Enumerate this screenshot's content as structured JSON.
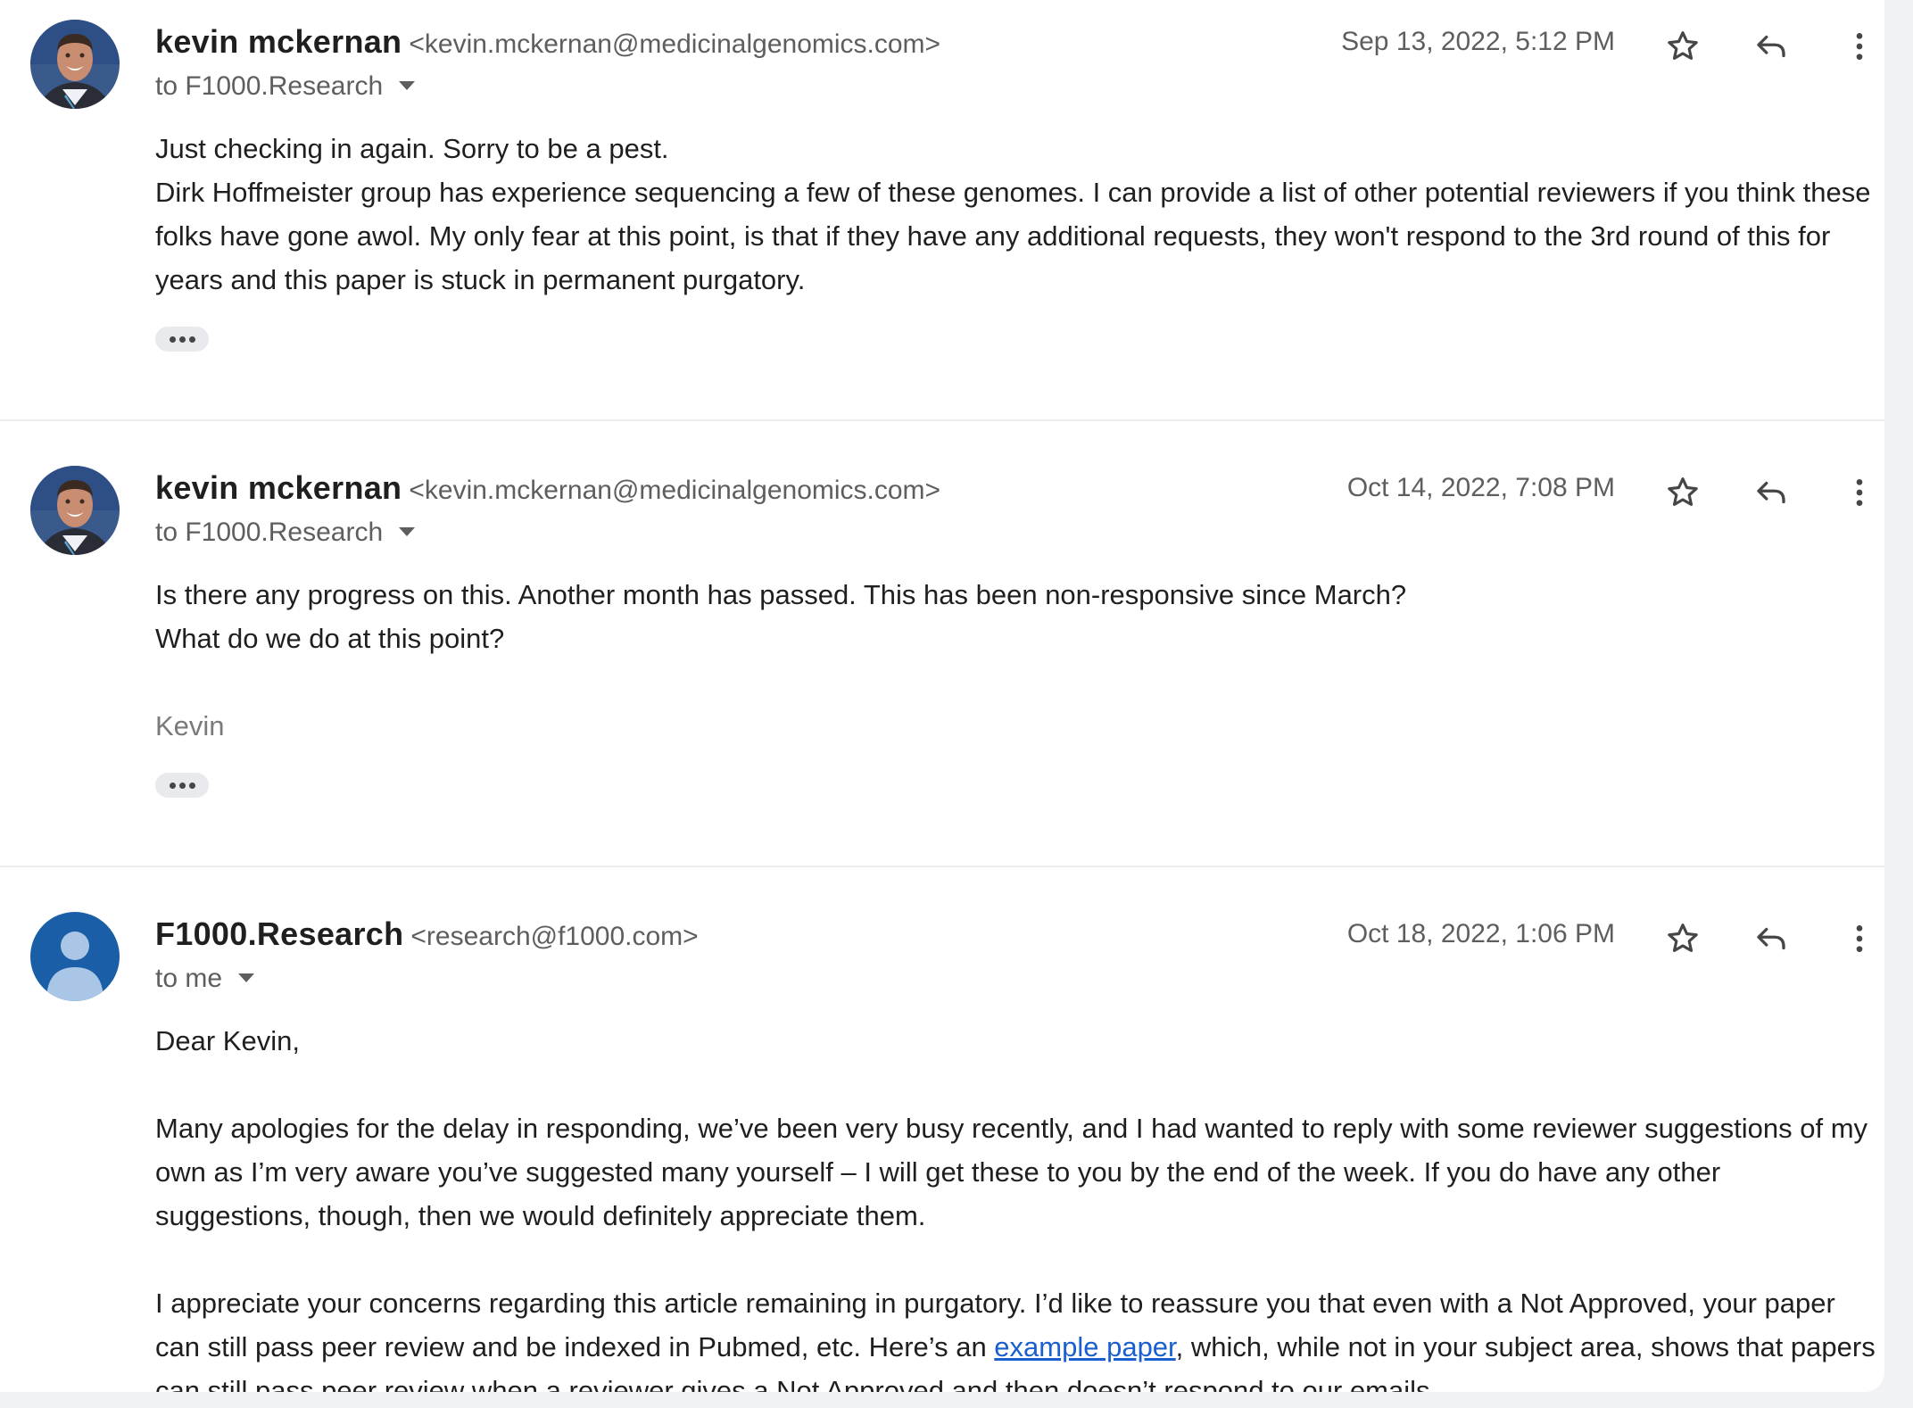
{
  "thread": {
    "messages": [
      {
        "sender_name": "kevin mckernan",
        "sender_email": "<kevin.mckernan@medicinalgenomics.com>",
        "to_label": "to F1000.Research",
        "date": "Sep 13, 2022, 5:12 PM",
        "avatar": "photo-avatar",
        "body": [
          "Just checking in again. Sorry to be a pest.",
          "Dirk Hoffmeister group has experience sequencing a few of these genomes. I can provide a list of other potential reviewers if you think these folks have gone awol. My only fear at this point, is that if they have any additional requests, they won't respond to the 3rd round of this for years and this paper is stuck in permanent purgatory."
        ]
      },
      {
        "sender_name": "kevin mckernan",
        "sender_email": "<kevin.mckernan@medicinalgenomics.com>",
        "to_label": "to F1000.Research",
        "date": "Oct 14, 2022, 7:08 PM",
        "avatar": "photo-avatar",
        "body": [
          "Is there any progress on this. Another month has passed. This has been non-responsive since March?",
          "What do we do at this point?"
        ],
        "signature": "Kevin"
      },
      {
        "sender_name": "F1000.Research",
        "sender_email": "<research@f1000.com>",
        "to_label": "to me",
        "date": "Oct 18, 2022, 1:06 PM",
        "avatar": "default-person-avatar",
        "body": [
          "Dear Kevin,",
          "Many apologies for the delay in responding, we’ve been very busy recently, and I had wanted to reply with some reviewer suggestions of my own as I’m very aware you’ve suggested many yourself – I will get these to you by the end of the week. If you do have any other suggestions, though, then we would definitely appreciate them."
        ],
        "para3_before": "I appreciate your concerns regarding this article remaining in purgatory. I’d like to reassure you that even with a Not Approved, your paper can still pass peer review and be indexed in Pubmed, etc. Here’s an ",
        "para3_link": "example paper",
        "para3_after": ", which, while not in your subject area, shows that papers can still pass peer review when a reviewer gives a Not Approved and then doesn’t respond to our emails."
      }
    ]
  },
  "icons": {
    "star": "star-outline-icon",
    "reply": "reply-arrow-icon",
    "more": "more-vertical-icon",
    "expand": "ellipsis-icon"
  },
  "colors": {
    "link": "#1a5fd0",
    "default_avatar_bg": "#1b5ea8",
    "default_avatar_fg": "#a9c6e6"
  }
}
